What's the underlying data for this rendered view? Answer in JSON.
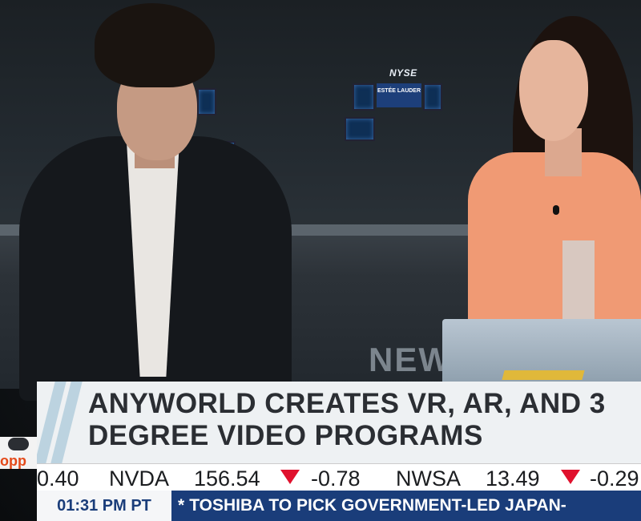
{
  "background": {
    "monitor_sign": "NYSE",
    "brand_screen": "ESTÉE LAUDER",
    "desk_logo": "NEW"
  },
  "lower_third": {
    "headline_line1": "ANYWORLD CREATES VR, AR, AND 3",
    "headline_line2": "DEGREE VIDEO PROGRAMS",
    "side_logo_text": "opp"
  },
  "ticker": {
    "items": [
      {
        "text": "0.40"
      },
      {
        "symbol": "NVDA",
        "price": "156.54",
        "change": "-0.78",
        "direction": "down"
      },
      {
        "symbol": "NWSA",
        "price": "13.49",
        "change": "-0.29",
        "direction": "down"
      }
    ]
  },
  "bottom_bar": {
    "time": "01:31 PM PT",
    "crawl_prefix": "*",
    "crawl_text": "TOSHIBA TO PICK GOVERNMENT-LED JAPAN-"
  },
  "colors": {
    "bottom_bar": "#1a3d7a",
    "down_arrow": "#e0112d",
    "headline_text": "#2b2e33",
    "host_blouse": "#f09a74"
  }
}
